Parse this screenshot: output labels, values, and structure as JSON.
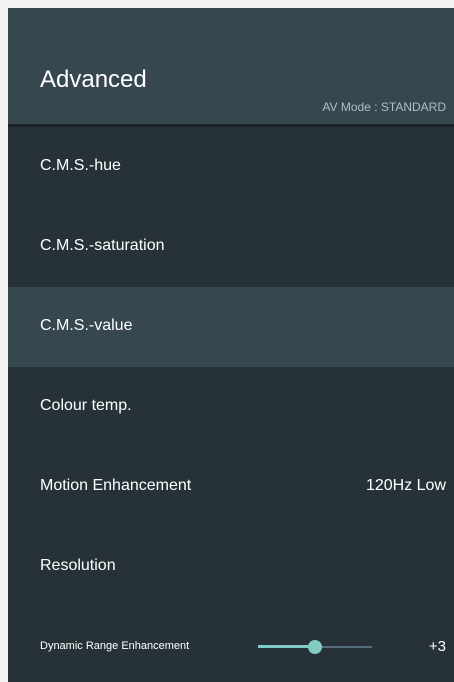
{
  "header": {
    "title": "Advanced",
    "av_mode": "AV Mode : STANDARD"
  },
  "menu": {
    "items": [
      {
        "label": "C.M.S.-hue",
        "value": ""
      },
      {
        "label": "C.M.S.-saturation",
        "value": ""
      },
      {
        "label": "C.M.S.-value",
        "value": "",
        "selected": true
      },
      {
        "label": "Colour temp.",
        "value": ""
      },
      {
        "label": "Motion Enhancement",
        "value": "120Hz Low"
      },
      {
        "label": "Resolution",
        "value": ""
      }
    ],
    "slider_item": {
      "label": "Dynamic Range Enhancement",
      "value": "+3",
      "level_fraction": 0.5
    }
  },
  "colors": {
    "page_background": "#f2f2f2",
    "panel_background": "#263238",
    "header_background": "#37474f",
    "selected_background": "#37474f",
    "accent": "#80cbc4",
    "secondary_text": "#b0bec5"
  }
}
